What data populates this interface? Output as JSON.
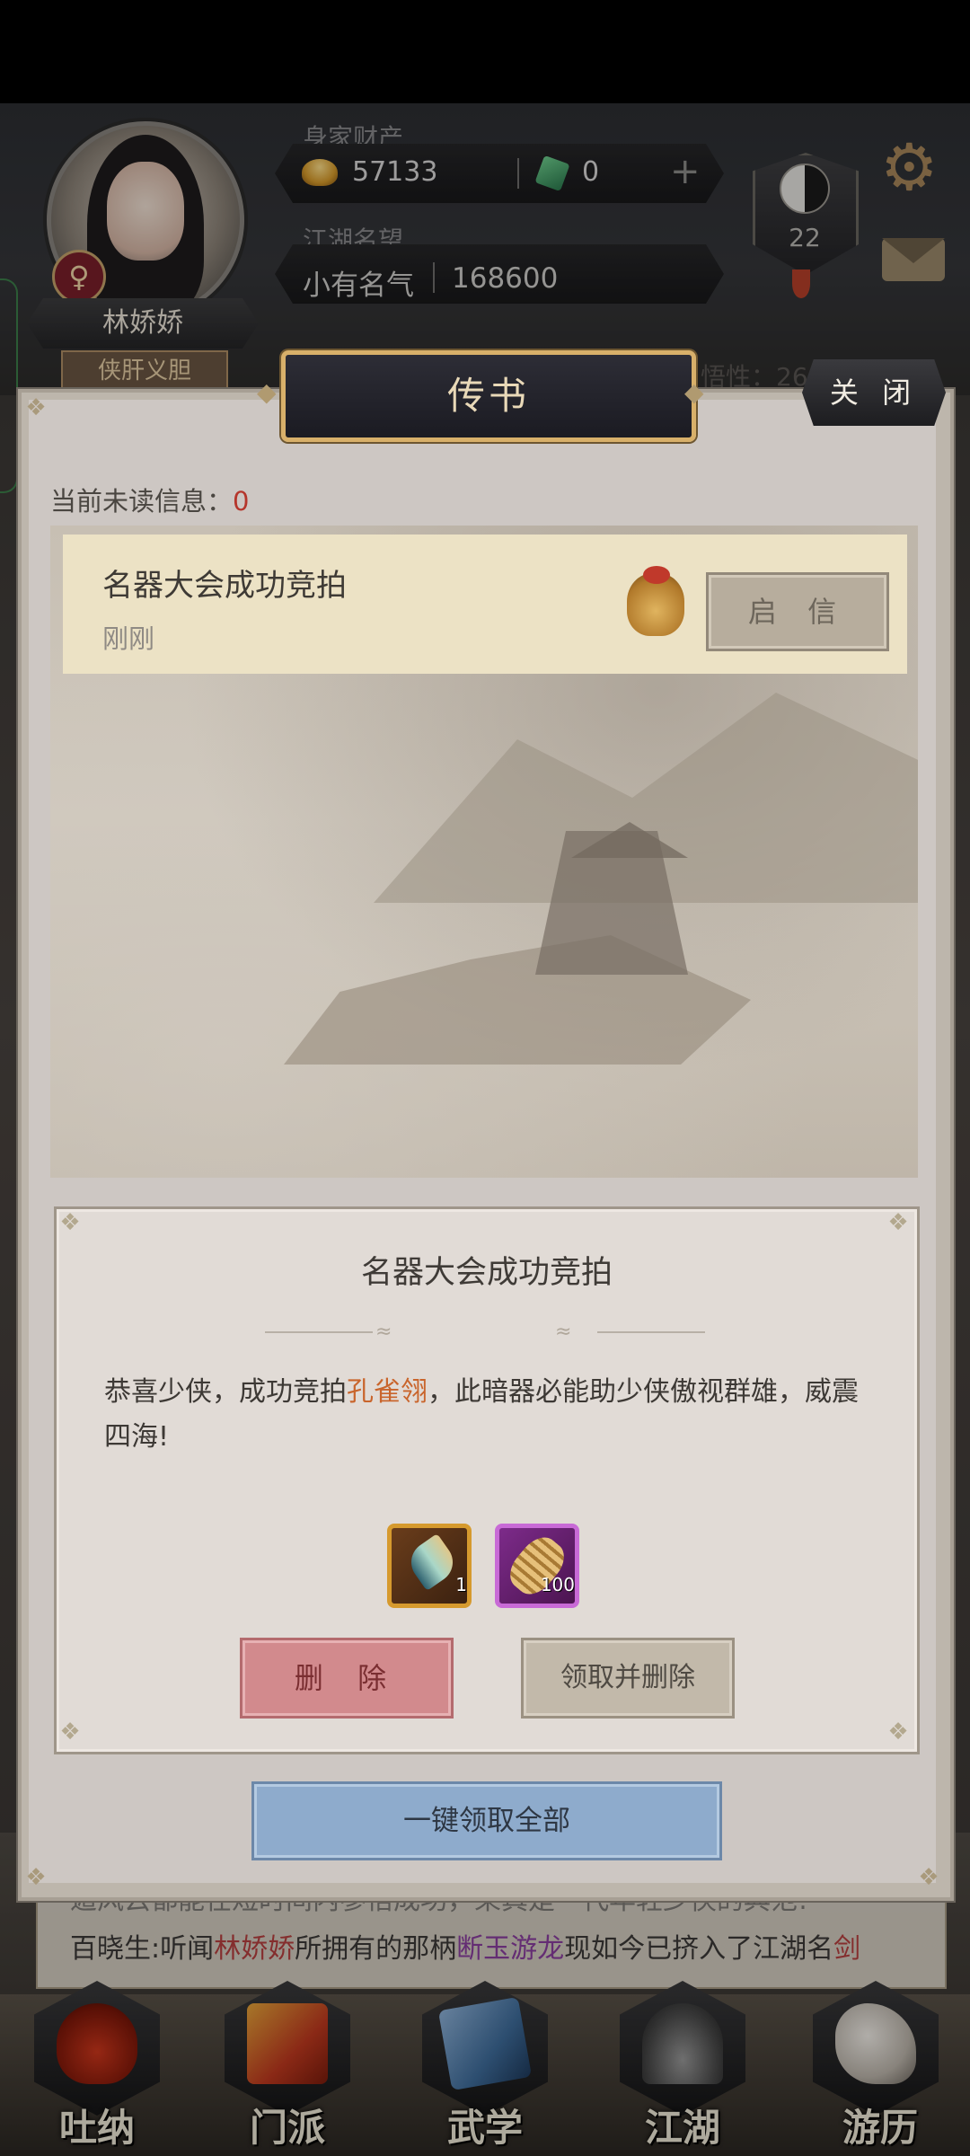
{
  "profile": {
    "name": "林娇娇",
    "title": "侠肝义胆",
    "gender_symbol": "♀",
    "level": "22"
  },
  "wealth": {
    "label": "身家财产",
    "gold": "57133",
    "jade": "0",
    "plus_symbol": "+"
  },
  "fame": {
    "label": "江湖名望",
    "rank": "小有名气",
    "value": "168600"
  },
  "background": {
    "insight_label": "悟性：26"
  },
  "modal": {
    "title": "传书",
    "close_label": "关 闭",
    "unread_label": "当前未读信息：",
    "unread_count": "0",
    "messages": [
      {
        "title": "名器大会成功竞拍",
        "time": "刚刚",
        "open_label": "启 信"
      }
    ],
    "detail": {
      "title": "名器大会成功竞拍",
      "body_prefix": "恭喜少侠，成功竞拍",
      "body_item": "孔雀翎",
      "body_suffix": "，此暗器必能助少侠傲视群雄，威震四海!",
      "rewards": [
        {
          "name": "peacock-feather-icon",
          "count": "1",
          "color": "#d69a2e"
        },
        {
          "name": "rope-material-icon",
          "count": "100",
          "color": "#c86ad6"
        }
      ],
      "delete_label": "删 除",
      "claim_delete_label": "领取并删除"
    },
    "claim_all_label": "一键领取全部"
  },
  "ticker": {
    "line1": "遁风云都能在短时间内参悟成功，果真是一代年轻少侠的典范!",
    "line2_prefix": "百晓生:听闻",
    "line2_name": "林娇娇",
    "line2_mid": "所拥有的那柄",
    "line2_weapon": "断玉游龙",
    "line2_suffix": "现如今已挤入了江湖名",
    "line2_tail": "剑"
  },
  "nav": {
    "items": [
      {
        "label": "吐纳",
        "icon": "gourd-icon"
      },
      {
        "label": "门派",
        "icon": "banner-icon"
      },
      {
        "label": "武学",
        "icon": "scroll-book-icon"
      },
      {
        "label": "江湖",
        "icon": "bamboo-hat-icon"
      },
      {
        "label": "游历",
        "icon": "horse-icon"
      }
    ]
  },
  "colors": {
    "accent_red": "#b5362c",
    "item_orange": "#c9652c",
    "banner_gold": "#d8b06a"
  }
}
